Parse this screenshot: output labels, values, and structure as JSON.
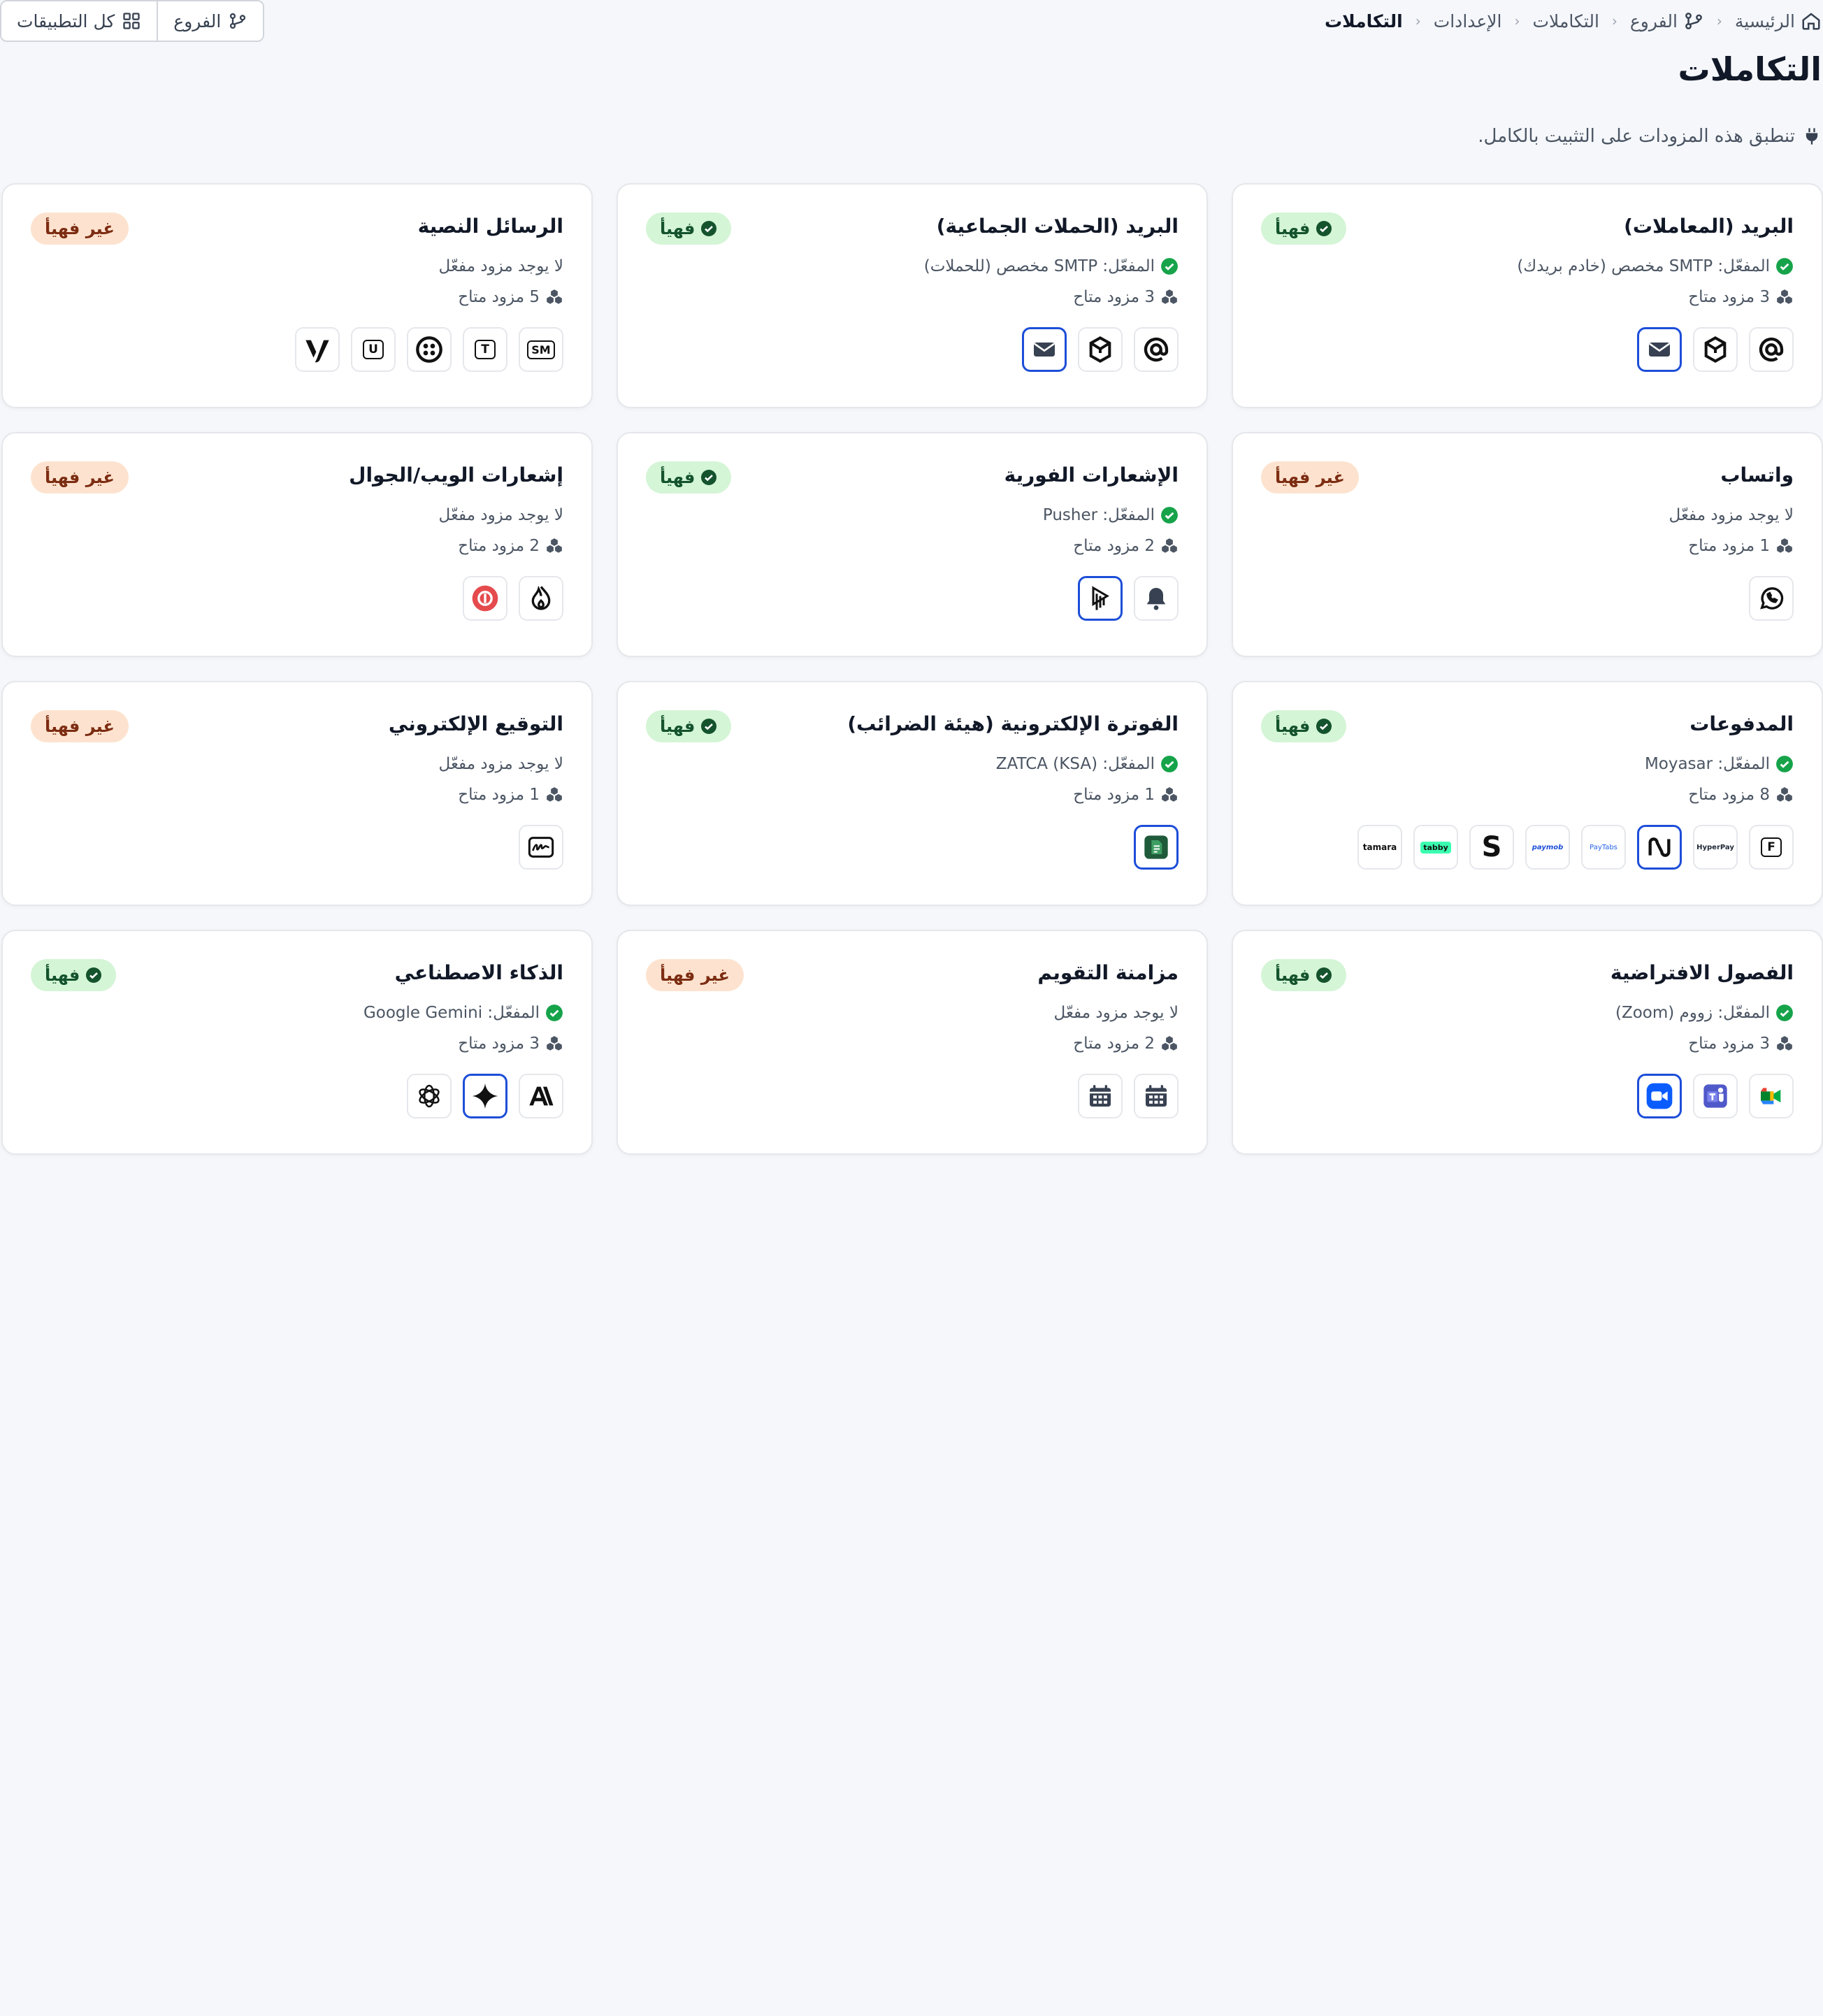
{
  "breadcrumb": {
    "items": [
      "الرئيسية",
      "الفروع",
      "التكاملات",
      "الإعدادات",
      "التكاملات"
    ]
  },
  "toolbar": {
    "all_apps_label": "كل التطبيقات",
    "branches_label": "الفروع"
  },
  "page": {
    "title": "التكاملات",
    "subtitle": "تنطبق هذه المزودات على التثبيت بالكامل."
  },
  "colors": {
    "ok_bg": "#d4f5d6",
    "no_bg": "#fde3cf",
    "active_border": "#1d4ed8",
    "check_green": "#16a34a"
  },
  "cards": [
    {
      "title": "البريد (المعاملات)",
      "status": "ok",
      "badge": "فهيأ",
      "line1": "المفعّل: SMTP مخصص (خادم بريدك)",
      "line1_icon": "check-circle-icon",
      "line2": "3 مزود متاح",
      "providers": [
        {
          "icon": "at-sign-icon"
        },
        {
          "icon": "mailbox-icon"
        },
        {
          "icon": "envelope-icon",
          "active": true
        }
      ]
    },
    {
      "title": "البريد (الحملات الجماعية)",
      "status": "ok",
      "badge": "فهيأ",
      "line1": "المفعّل: SMTP مخصص (للحملات)",
      "line1_icon": "check-circle-icon",
      "line2": "3 مزود متاح",
      "providers": [
        {
          "icon": "at-sign-icon"
        },
        {
          "icon": "mailbox-icon"
        },
        {
          "icon": "envelope-icon",
          "active": true
        }
      ]
    },
    {
      "title": "الرسائل النصية",
      "status": "no",
      "badge": "غير فهيأ",
      "line1": "لا يوجد مزود مفعّل",
      "line1_icon": "",
      "line2": "5 مزود متاح",
      "providers": [
        {
          "icon": "sm-logo-icon",
          "text": "SM"
        },
        {
          "icon": "t-logo-icon",
          "text": "T"
        },
        {
          "icon": "twilio-icon"
        },
        {
          "icon": "u-logo-icon",
          "text": "U"
        },
        {
          "icon": "vonage-icon"
        }
      ]
    },
    {
      "title": "واتساب",
      "status": "no",
      "badge": "غير فهيأ",
      "line1": "لا يوجد مزود مفعّل",
      "line1_icon": "",
      "line2": "1 مزود متاح",
      "providers": [
        {
          "icon": "whatsapp-icon"
        }
      ]
    },
    {
      "title": "الإشعارات الفورية",
      "status": "ok",
      "badge": "فهيأ",
      "line1": "المفعّل: Pusher",
      "line1_icon": "check-circle-icon",
      "line2": "2 مزود متاح",
      "providers": [
        {
          "icon": "bell-icon"
        },
        {
          "icon": "pusher-icon",
          "active": true
        }
      ]
    },
    {
      "title": "إشعارات الويب/الجوال",
      "status": "no",
      "badge": "غير فهيأ",
      "line1": "لا يوجد مزود مفعّل",
      "line1_icon": "",
      "line2": "2 مزود متاح",
      "providers": [
        {
          "icon": "flame-icon"
        },
        {
          "icon": "onesignal-icon"
        }
      ]
    },
    {
      "title": "المدفوعات",
      "status": "ok",
      "badge": "فهيأ",
      "line1": "المفعّل: Moyasar",
      "line1_icon": "check-circle-icon",
      "line2": "8 مزود متاح",
      "providers": [
        {
          "icon": "f-logo-icon",
          "text": "F"
        },
        {
          "icon": "hyperpay-icon",
          "text": "HyperPay"
        },
        {
          "icon": "moyasar-icon",
          "active": true
        },
        {
          "icon": "paytabs-icon",
          "text": "PayTabs"
        },
        {
          "icon": "paymob-icon",
          "text": "paymob"
        },
        {
          "icon": "stripe-icon",
          "text": "S"
        },
        {
          "icon": "tabby-icon",
          "text": "tabby"
        },
        {
          "icon": "tamara-icon",
          "text": "tamara"
        }
      ]
    },
    {
      "title": "الفوترة الإلكترونية (هيئة الضرائب)",
      "status": "ok",
      "badge": "فهيأ",
      "line1": "المفعّل: ZATCA (KSA)",
      "line1_icon": "check-circle-icon",
      "line2": "1 مزود متاح",
      "providers": [
        {
          "icon": "zatca-icon",
          "active": true
        }
      ]
    },
    {
      "title": "التوقيع الإلكتروني",
      "status": "no",
      "badge": "غير فهيأ",
      "line1": "لا يوجد مزود مفعّل",
      "line1_icon": "",
      "line2": "1 مزود متاح",
      "providers": [
        {
          "icon": "signature-icon"
        }
      ]
    },
    {
      "title": "الفصول الافتراضية",
      "status": "ok",
      "badge": "فهيأ",
      "line1": "المفعّل: زووم (Zoom)",
      "line1_icon": "check-circle-icon",
      "line2": "3 مزود متاح",
      "providers": [
        {
          "icon": "google-meet-icon"
        },
        {
          "icon": "ms-teams-icon"
        },
        {
          "icon": "zoom-icon",
          "active": true
        }
      ]
    },
    {
      "title": "مزامنة التقويم",
      "status": "no",
      "badge": "غير فهيأ",
      "line1": "لا يوجد مزود مفعّل",
      "line1_icon": "",
      "line2": "2 مزود متاح",
      "providers": [
        {
          "icon": "calendar-icon"
        },
        {
          "icon": "calendar-icon"
        }
      ]
    },
    {
      "title": "الذكاء الاصطناعي",
      "status": "ok",
      "badge": "فهيأ",
      "line1": "المفعّل: Google Gemini",
      "line1_icon": "check-circle-icon",
      "line2": "3 مزود متاح",
      "providers": [
        {
          "icon": "anthropic-icon"
        },
        {
          "icon": "gemini-icon",
          "active": true
        },
        {
          "icon": "openai-icon"
        }
      ]
    }
  ]
}
